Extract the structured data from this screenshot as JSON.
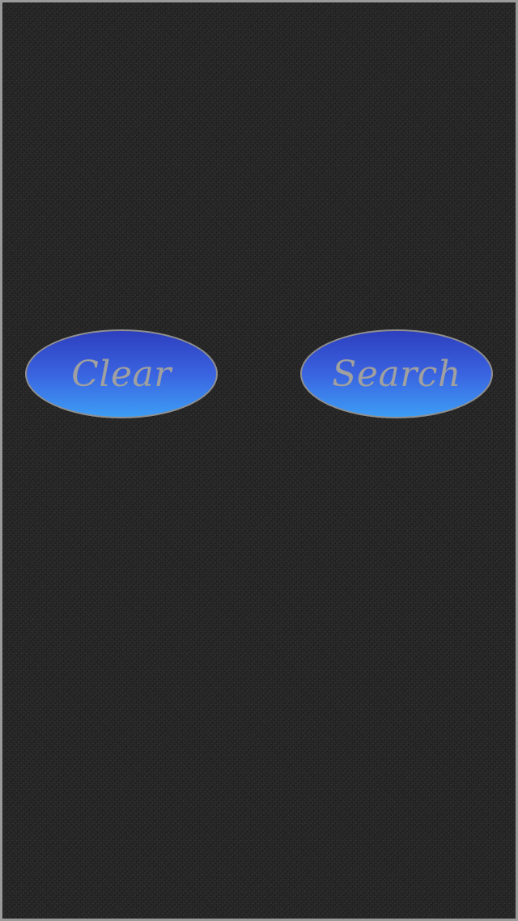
{
  "colors": {
    "background": "#262626",
    "border": "#9a9a9a",
    "button_gradient_top": "#2d3fbf",
    "button_gradient_bottom": "#3d9df5",
    "button_text": "#a0a0a0"
  },
  "buttons": {
    "clear_label": "Clear",
    "search_label": "Search"
  }
}
